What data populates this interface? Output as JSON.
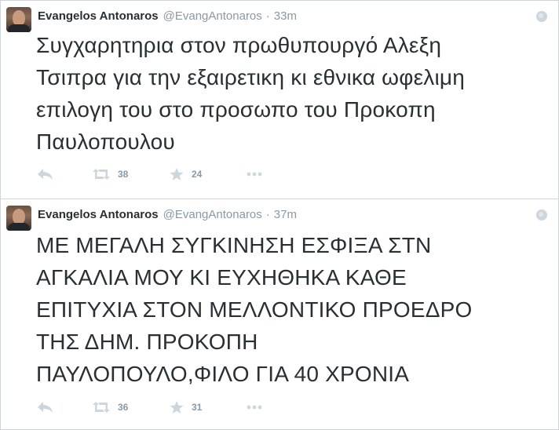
{
  "tweets": [
    {
      "author_name": "Evangelos Antonaros",
      "handle": "@EvangAntonaros",
      "separator": "·",
      "time": "33m",
      "text": "Συγχαρητηρια στον πρωθυπουργό Αλεξη\nΤσιπρα για την εξαιρετικη  κι εθνικα ωφελιμη\nεπιλογη του στο προσωπο του Προκοπη\nΠαυλοπουλου",
      "retweets": "38",
      "favorites": "24"
    },
    {
      "author_name": "Evangelos Antonaros",
      "handle": "@EvangAntonaros",
      "separator": "·",
      "time": "37m",
      "text": "ΜΕ ΜΕΓΑΛΗ ΣΥΓΚΙΝΗΣΗ ΕΣΦΙΞΑ ΣΤΝ\nΑΓΚΑΛΙΑ ΜΟΥ ΚΙ ΕΥΧΗΘΗΚΑ ΚΑΘΕ\nΕΠΙΤΥΧΙΑ ΣΤΟΝ ΜΕΛΛΟΝΤΙΚΟ ΠΡΟΕΔΡΟ\nΤΗΣ ΔΗΜ. ΠΡΟΚΟΠΗ\nΠΑΥΛΟΠΟΥΛΟ,ΦΙΛΟ ΓΙΑ 40 ΧΡΟΝΙΑ",
      "retweets": "36",
      "favorites": "31"
    }
  ],
  "icons": {
    "reply": "reply-icon",
    "retweet": "retweet-icon",
    "favorite": "star-icon",
    "more": "more-icon",
    "globe": "globe-icon"
  },
  "colors": {
    "text": "#292f33",
    "muted": "#8899a6",
    "icon": "#ccd6dd",
    "handle_link": "#0084b4"
  }
}
